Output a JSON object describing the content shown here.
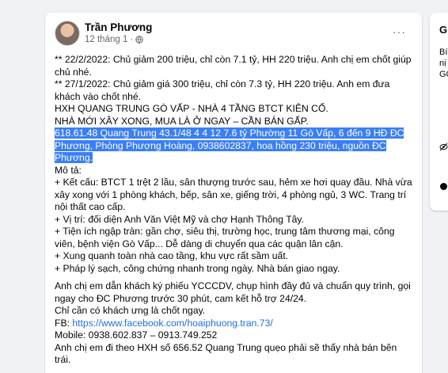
{
  "post": {
    "author": "Trần Phương",
    "date": "12 tháng 1",
    "dot": "·",
    "more": "···",
    "lines": {
      "l1": "** 22/2/2022: Chủ giảm 200 triệu, chỉ còn 7.1 tỷ, HH 220 triệu. Anh chị em chốt giúp chủ nhé.",
      "l2": "** 27/1/2022: Chủ giảm giá 300 triệu, chỉ còn 7.3 tỷ, HH 220 triệu. Anh em đưa khách vào chốt nhé.",
      "l3": "HXH QUANG TRUNG GÒ VẤP - NHÀ 4 TẦNG BTCT KIÊN CỐ.",
      "l4": "NHÀ MỚI XÂY XONG, MUA LÀ Ở NGAY – CẦN BÁN GẤP.",
      "l5": "618.61.48 Quang Trung 43.1/48 4 4 12 7.6 tỷ Phường 11 Gò Vấp, 6 đến 9 HĐ ĐC Phương, Phòng Phượng Hoàng, 0938602837, hoa hồng 230 triệu, nguồn ĐC Phương.",
      "l6": "Mô tả:",
      "l7": "+ Kết cấu: BTCT 1 trệt 2 lầu, sân thượng trước sau, hẻm xe hơi quay đầu. Nhà vừa xây xong với 1 phòng khách, bếp, sân xe, giếng trời, 4 phòng ngủ, 3 WC. Trang trí nội thất cao cấp.",
      "l8": "+ Vị trí: đối diện Anh Văn Việt Mỹ và chợ Hạnh Thông Tây.",
      "l9": "+ Tiện ích ngập tràn: gần chợ, siêu thị, trường học, trung tâm thương mại, công viên, bệnh viện Gò Vấp... Dễ dàng di chuyển qua các quận lân cận.",
      "l10": "+ Xung quanh toàn nhà cao tầng, khu vực rất sầm uất.",
      "l11": "+ Pháp lý sạch, công chứng nhanh trong ngày. Nhà bán giao ngay.",
      "l12": "Anh chị em dẫn khách ký phiếu YCCCDV, chụp hình đầy đủ và chuẩn quy trình, gọi ngay cho ĐC Phương trước 30 phút, cam kết hỗ trợ 24/24.",
      "l13": "Chỉ cần có khách ưng là chốt ngay.",
      "fb_label": "FB: ",
      "fb_link": "https://www.facebook.com/hoaiphuong.tran.73/",
      "l14": "Mobile: 0938.602.837 – 0913.749.252",
      "l15": "Anh chị em đi theo HXH số 656.52 Quang Trung quẹo phải sẽ thấy nhà bán bên trái."
    }
  },
  "right_card": {
    "title": "Gi",
    "t1": "Bí",
    "t2": "nị",
    "t3": "GÓ"
  },
  "colors": {
    "highlight": "#3a7ff5",
    "link": "#216fdb",
    "background": "#f0f2f5"
  }
}
